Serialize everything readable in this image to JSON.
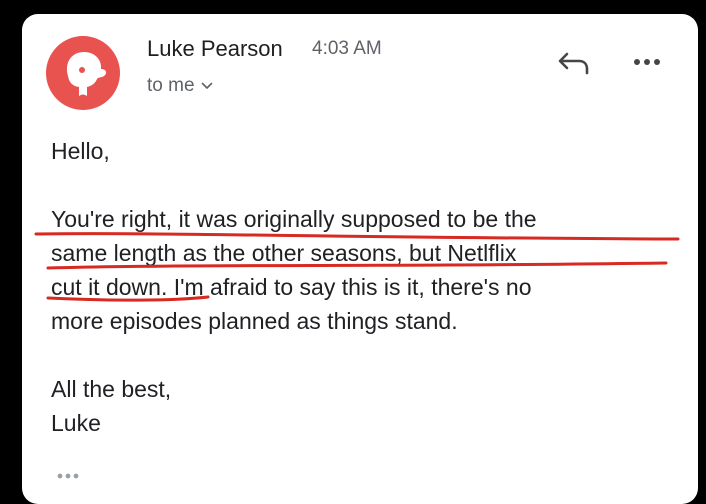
{
  "email": {
    "sender_name": "Luke Pearson",
    "time": "4:03 AM",
    "recipient": "to me",
    "greeting": "Hello,",
    "body_lines": [
      "You're right, it was originally supposed to be the",
      "same length as the other seasons, but Netlflix",
      "cut it down. I'm afraid to say this is it, there's no",
      "more episodes planned as things stand."
    ],
    "signoff": "All the best,",
    "signature": "Luke"
  },
  "icons": {
    "avatar": "avatar-icon",
    "recipient_toggle": "chevron-down-icon",
    "reply": "reply-icon",
    "more": "more-horizontal-icon",
    "trimmed": "ellipsis-icon"
  },
  "colors": {
    "avatar": "#e8524f",
    "underline": "#d62a22",
    "text": "#202124",
    "secondary": "#5f6368"
  }
}
